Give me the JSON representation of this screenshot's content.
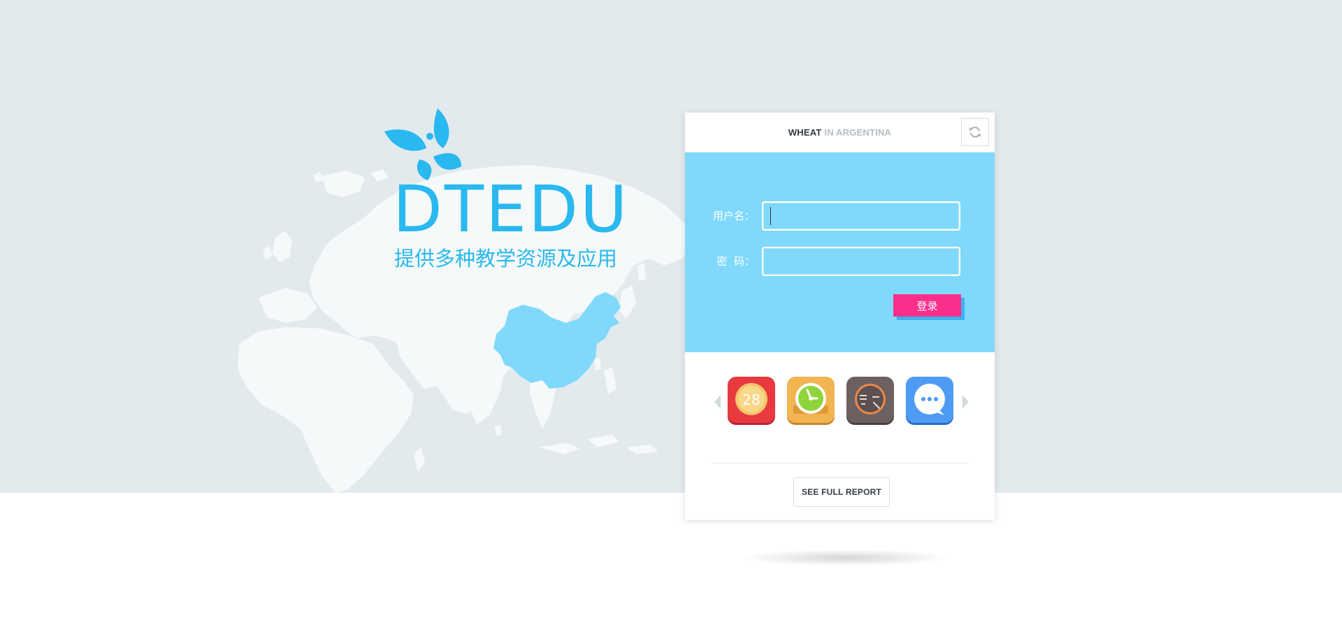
{
  "brand": {
    "name": "DTEDU",
    "tagline": "提供多种教学资源及应用",
    "color": "#29b8ef"
  },
  "panel": {
    "header_strong": "WHEAT",
    "header_light": "IN ARGENTINA",
    "refresh_icon": "refresh-icon"
  },
  "login": {
    "username_label": "用户名：",
    "username_value": "",
    "password_label": "密  码：",
    "password_value": "",
    "submit_label": "登录",
    "accent_color": "#fa2f8b",
    "area_color": "#80d9fb"
  },
  "apps": {
    "items": [
      {
        "icon": "calendar-icon",
        "text": "28",
        "color": "#e8393f"
      },
      {
        "icon": "clock-icon",
        "color": "#f2a93b"
      },
      {
        "icon": "calculator-icon",
        "color": "#6b5f5f"
      },
      {
        "icon": "chat-icon",
        "color": "#3f8ef0"
      }
    ]
  },
  "report": {
    "button_label": "SEE FULL REPORT"
  },
  "map": {
    "highlight_color": "#80d9fb"
  }
}
